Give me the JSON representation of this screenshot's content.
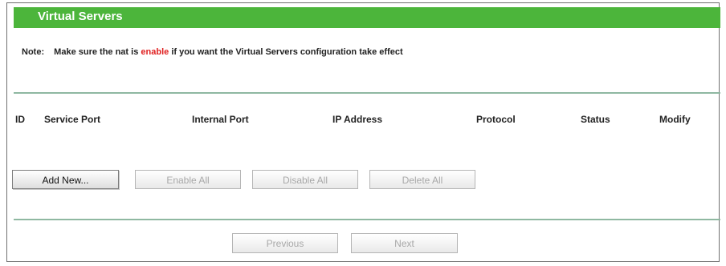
{
  "header": {
    "title": "Virtual Servers"
  },
  "note": {
    "label": "Note:",
    "text_before": "Make sure the nat is",
    "highlight": "enable",
    "text_after": "if you want the Virtual Servers configuration take effect"
  },
  "table": {
    "columns": [
      "ID",
      "Service Port",
      "Internal Port",
      "IP Address",
      "Protocol",
      "Status",
      "Modify"
    ],
    "rows": []
  },
  "actions": {
    "add_new": "Add New...",
    "enable_all": "Enable All",
    "disable_all": "Disable All",
    "delete_all": "Delete All"
  },
  "pagination": {
    "previous": "Previous",
    "next": "Next"
  },
  "colors": {
    "header_bg": "#4cb53b",
    "highlight": "#e02020",
    "rule": "#8fb8a1"
  }
}
